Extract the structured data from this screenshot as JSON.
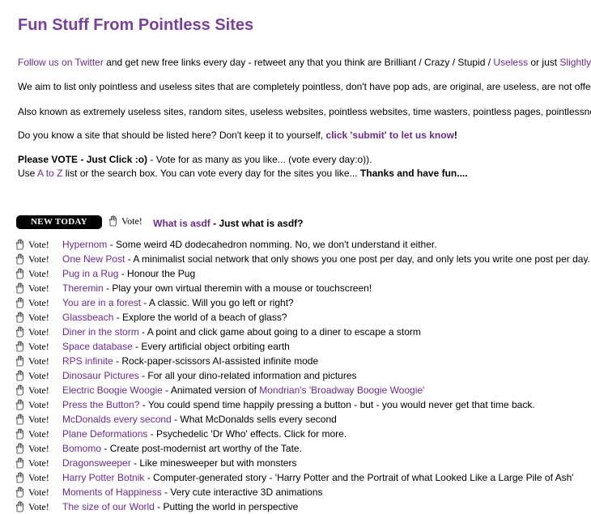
{
  "title": "Fun Stuff From Pointless Sites",
  "intro": {
    "line1": {
      "link1": "Follow us on Twitter",
      "text1": " and get new free links every day - retweet any that you think are Brilliant / Crazy / Stupid / ",
      "link2": "Useless",
      "text2": " or just ",
      "link3": "Slightly"
    },
    "line2": "We aim to list only pointless and useless sites that are completely pointless, don't have pop ads, are original, are useless, are not offe",
    "line3": "Also known as extremely useless sites, random sites, useless websites, pointless websites, time wasters, pointless pages, pointlessne",
    "line4": {
      "text1": "Do you know a site that should be listed here? Don't keep it to yourself, ",
      "link": "click 'submit' to let us know",
      "text2": "!"
    },
    "line5": {
      "bold": "Please VOTE - Just Click :o)",
      "text": " - Vote for as many as you like... (vote every day:o))."
    },
    "line6": {
      "text1": "Use ",
      "link": "A to Z",
      "text2": " list or the search box. You can vote every day for the sites you like... ",
      "bold": "Thanks and have fun...."
    }
  },
  "new_today": {
    "banner": "NEW TODAY",
    "vote": "Vote!",
    "link": "What is asdf",
    "desc": " - Just what is asdf?"
  },
  "sites": [
    {
      "vote": "Vote!",
      "link": "Hypernom",
      "desc": " - Some weird 4D dodecahedron nomming. No, we don't understand it either."
    },
    {
      "vote": "Vote!",
      "link": "One New Post",
      "desc": " - A minimalist social network that only shows you one post per day, and only lets you write one post per day."
    },
    {
      "vote": "Vote!",
      "link": "Pug in a Rug",
      "desc": " - Honour the Pug"
    },
    {
      "vote": "Vote!",
      "link": "Theremin",
      "desc": " - Play your own virtual theremin with a mouse or touchscreen!"
    },
    {
      "vote": "Vote!",
      "link": "You are in a forest",
      "desc": " - A classic. Will you go left or right?"
    },
    {
      "vote": "Vote!",
      "link": "Glassbeach",
      "desc": " - Explore the world of a beach of glass?"
    },
    {
      "vote": "Vote!",
      "link": "Diner in the storm",
      "desc": " - A point and click game about going to a diner to escape a storm"
    },
    {
      "vote": "Vote!",
      "link": "Space database",
      "desc": " - Every artificial object orbiting earth"
    },
    {
      "vote": "Vote!",
      "link": "RPS infinite",
      "desc": " - Rock-paper-scissors AI-assisted infinite mode"
    },
    {
      "vote": "Vote!",
      "link": "Dinosaur Pictures",
      "desc": " - For all your dino-related information and pictures"
    },
    {
      "vote": "Vote!",
      "link": "Electric Boogie Woogie",
      "desc": " - Animated version of ",
      "link2": "Mondrian's 'Broadway Boogie Woogie'"
    },
    {
      "vote": "Vote!",
      "link": "Press the Button?",
      "desc": " - You could spend time happily pressing a button - but - you would never get that time back."
    },
    {
      "vote": "Vote!",
      "link": "McDonalds every second",
      "desc": " - What McDonalds sells every second"
    },
    {
      "vote": "Vote!",
      "link": "Plane Deformations",
      "desc": " - Psychedelic 'Dr Who' effects. Click for more."
    },
    {
      "vote": "Vote!",
      "link": "Bomomo",
      "desc": " - Create post-modernist art worthy of the Tate."
    },
    {
      "vote": "Vote!",
      "link": "Dragonsweeper",
      "desc": " - Like minesweeper but with monsters"
    },
    {
      "vote": "Vote!",
      "link": "Harry Potter Botnik",
      "desc": " - Computer-generated story - 'Harry Potter and the Portrait of what Looked Like a Large Pile of Ash'"
    },
    {
      "vote": "Vote!",
      "link": "Moments of Happiness",
      "desc": " - Very cute interactive 3D animations"
    },
    {
      "vote": "Vote!",
      "link": "The size of our World",
      "desc": " - Putting the world in perspective"
    }
  ]
}
